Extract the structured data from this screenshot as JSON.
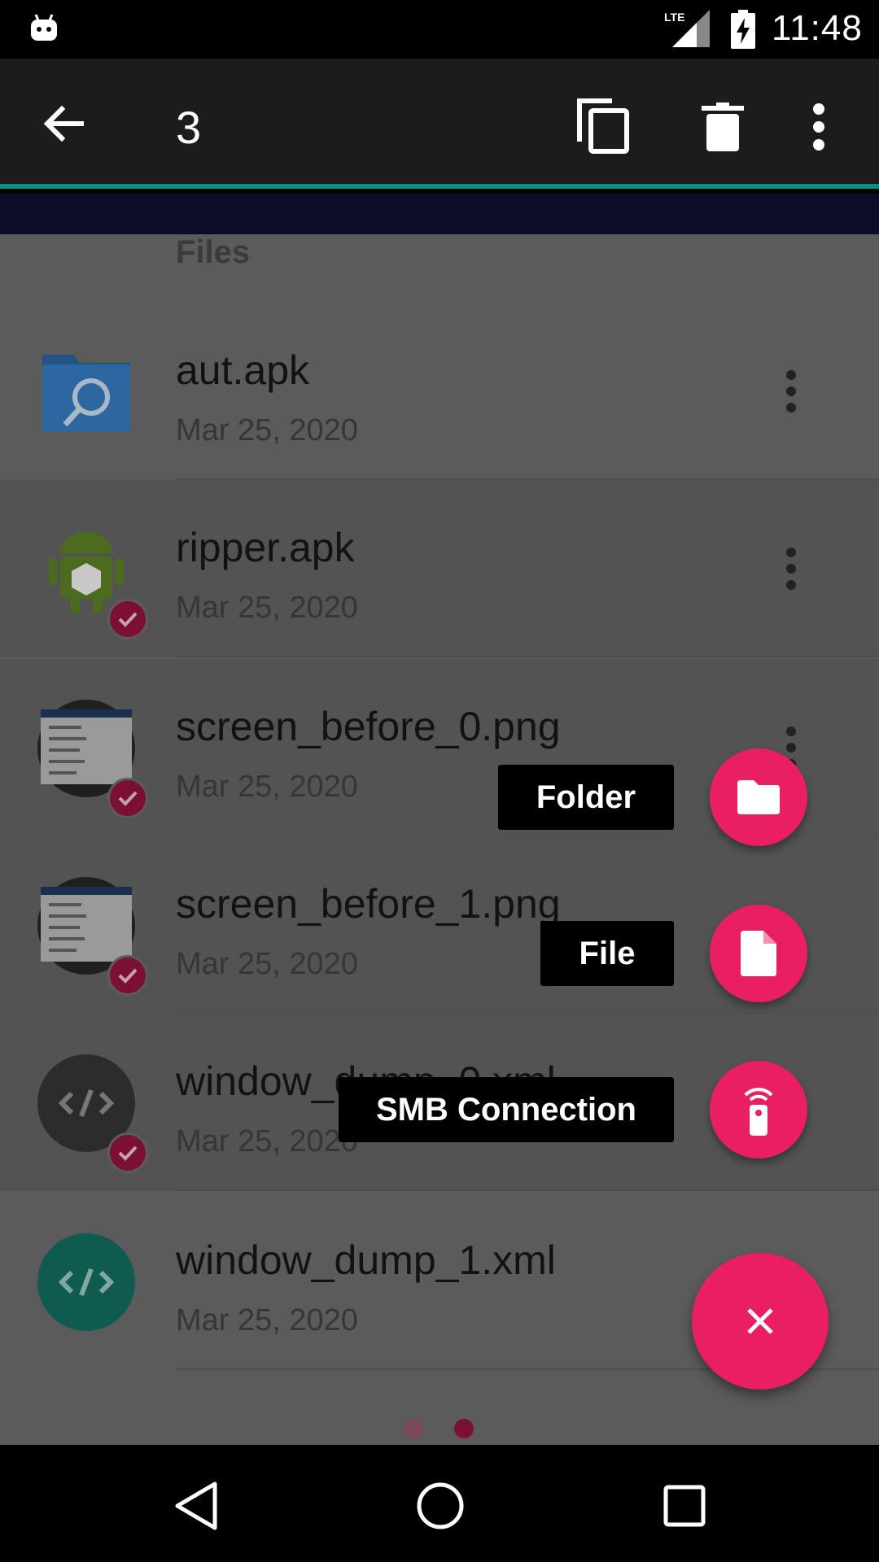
{
  "status_bar": {
    "time": "11:48",
    "network": "LTE",
    "icons": [
      "android-robot-icon",
      "lte-signal-icon",
      "battery-charging-icon"
    ]
  },
  "action_bar": {
    "selected_count": "3",
    "back_icon": "arrow-back-icon",
    "actions": [
      "copy-icon",
      "delete-icon",
      "overflow-menu-icon"
    ]
  },
  "list": {
    "section_title": "Files",
    "items": [
      {
        "name": "aut.apk",
        "date": "Mar 25, 2020",
        "icon": "app-search-icon",
        "selected": false
      },
      {
        "name": "ripper.apk",
        "date": "Mar 25, 2020",
        "icon": "android-package-icon",
        "selected": true
      },
      {
        "name": "screen_before_0.png",
        "date": "Mar 25, 2020",
        "icon": "image-thumbnail",
        "selected": true
      },
      {
        "name": "screen_before_1.png",
        "date": "Mar 25, 2020",
        "icon": "image-thumbnail",
        "selected": true
      },
      {
        "name": "window_dump_0.xml",
        "date": "Mar 25, 2020",
        "icon": "code-file-icon",
        "selected": true
      },
      {
        "name": "window_dump_1.xml",
        "date": "Mar 25, 2020",
        "icon": "code-file-icon",
        "selected": false
      }
    ]
  },
  "speed_dial": {
    "options": [
      {
        "label": "Folder",
        "icon": "folder-icon"
      },
      {
        "label": "File",
        "icon": "file-icon"
      },
      {
        "label": "SMB Connection",
        "icon": "remote-icon"
      }
    ],
    "close_icon": "close-icon",
    "accent_color": "#e91e63"
  },
  "pager": {
    "pages": 2,
    "current": 2
  },
  "nav_bar": {
    "icons": [
      "back-triangle-icon",
      "home-circle-icon",
      "recents-square-icon"
    ]
  }
}
